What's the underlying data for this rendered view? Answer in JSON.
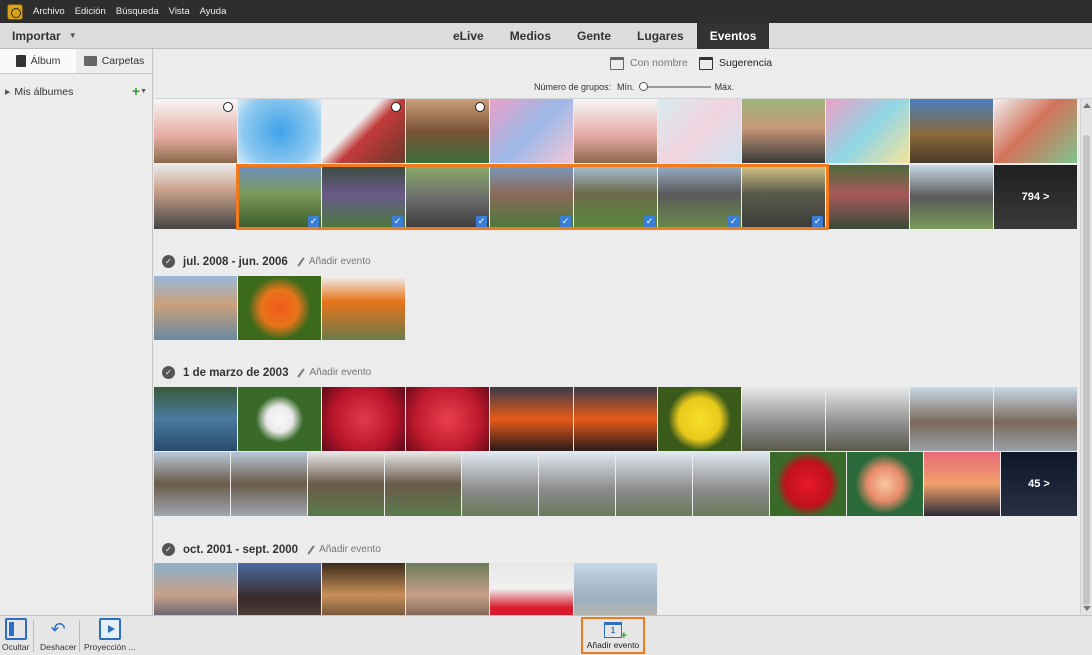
{
  "menu": [
    "Archivo",
    "Edición",
    "Búsqueda",
    "Vista",
    "Ayuda"
  ],
  "import_label": "Importar",
  "tabs": [
    "eLive",
    "Medios",
    "Gente",
    "Lugares",
    "Eventos"
  ],
  "active_tab": "Eventos",
  "left_panel": {
    "tab_album": "Álbum",
    "tab_folders": "Carpetas",
    "my_albums": "Mis álbumes"
  },
  "view_modes": {
    "named": "Con nombre",
    "suggestion": "Sugerencia"
  },
  "groups": {
    "label": "Número de grupos:",
    "min": "Mín.",
    "max": "Máx."
  },
  "top_group": {
    "more_label": "794 >",
    "row1": [
      {
        "name": "flowers-pots-photo",
        "color": "linear-gradient(#f7f7f7,#e5a9a0 60%,#8a6a4a)",
        "play": true
      },
      {
        "name": "blue-watercolor-photo",
        "color": "radial-gradient(circle,#3fa2e8,#8fcaf0 70%,#d8ecf7)",
        "play": false
      },
      {
        "name": "girl-painting-wall-photo",
        "color": "linear-gradient(135deg,#eee 40%,#c23a3a 55%,#6a3a2a)",
        "play": true
      },
      {
        "name": "smiling-girl-photo",
        "color": "linear-gradient(#c9a07a,#7a5236 50%,#3a6e3a)",
        "play": true
      },
      {
        "name": "pink-watercolor-photo",
        "color": "linear-gradient(135deg,#e9a0c8,#9bb9e8 50%,#f3c6d8)",
        "play": false
      },
      {
        "name": "flowers-pots-photo-2",
        "color": "linear-gradient(#f7f7f7,#e3a6a0 60%,#8a6a4a)",
        "play": false
      },
      {
        "name": "pastel-watercolor-photo",
        "color": "linear-gradient(135deg,#d9ecef,#f1d3df 50%,#cfe3ef)",
        "play": false
      },
      {
        "name": "smiling-man-photo",
        "color": "linear-gradient(#9bb57a,#c79878 45%,#3a3a3a)",
        "play": false
      },
      {
        "name": "rainbow-watercolor-photo",
        "color": "linear-gradient(135deg,#ee9fc4,#8fd6e6 50%,#f6e39a)",
        "play": false
      },
      {
        "name": "mountain-biker-photo",
        "color": "linear-gradient(#4a7fc0,#8a6a3a 55%,#4a3a2a)",
        "play": false
      },
      {
        "name": "green-watercolor-photo",
        "color": "linear-gradient(135deg,#f1f1f1,#d2735a 45%,#7fc48f)",
        "play": false
      }
    ],
    "row2": [
      {
        "name": "man-suit-photo",
        "color": "linear-gradient(#e9e9e9,#c9a08a 40%,#444)",
        "checked": false
      },
      {
        "name": "family-lawn-photo-1",
        "color": "linear-gradient(#6a8fc0,#7a9a5a 45%,#3a5a2a)",
        "checked": true
      },
      {
        "name": "family-lawn-photo-2",
        "color": "linear-gradient(#3a4a3a,#6a5a8a 45%,#4a7a3a)",
        "checked": true
      },
      {
        "name": "family-road-photo-1",
        "color": "linear-gradient(#8aaa6a,#6a6a6a 55%,#3a3a3a)",
        "checked": true
      },
      {
        "name": "family-lawn-photo-3",
        "color": "linear-gradient(#7a9ac0,#8a6a5a 45%,#4a7a3a)",
        "checked": true
      },
      {
        "name": "family-lawn-photo-4",
        "color": "linear-gradient(#aac0d8,#6a6a4a 45%,#5a8a3a)",
        "checked": true
      },
      {
        "name": "family-road-photo-2",
        "color": "linear-gradient(#9ab0c8,#5a5a5a 45%,#6a8a4a)",
        "checked": true
      },
      {
        "name": "family-road-photo-3",
        "color": "linear-gradient(#d8c88a,#5a5a4a 45%,#3a3a3a)",
        "checked": true
      },
      {
        "name": "family-bench-photo",
        "color": "linear-gradient(#4a6a3a,#a85a5a 45%,#3a4a3a)",
        "checked": false
      },
      {
        "name": "family-road-photo-4",
        "color": "linear-gradient(#c8d8e8,#5a5a5a 50%,#7a9a5a)",
        "checked": false
      },
      {
        "name": "more-photos-tile",
        "color": "linear-gradient(#3a3a3a,#6a6a6a)",
        "checked": false,
        "more": true
      }
    ]
  },
  "events": [
    {
      "title": "jul. 2008 - jun. 2006",
      "add_label": "Añadir evento",
      "photos": [
        {
          "name": "girl-lake-photo",
          "color": "linear-gradient(#9ab8d8,#c9a07a 45%,#6a8aa0)"
        },
        {
          "name": "orange-poppy-photo",
          "color": "radial-gradient(circle,#f05a1a,#e8741a 35%,#3a6a1a 60%)"
        },
        {
          "name": "poppy-field-photo",
          "color": "linear-gradient(#f1f1f1,#e8741a 40%,#6a7a4a)"
        }
      ]
    },
    {
      "title": "1 de marzo de 2003",
      "add_label": "Añadir evento",
      "more_label": "45 >",
      "row1": [
        {
          "name": "wakeboard-photo",
          "color": "linear-gradient(#3a5a3a,#4a7aa0 50%,#2a4a6a)"
        },
        {
          "name": "white-flower-photo",
          "color": "radial-gradient(circle,#fafafa,#eaeaea 25%,#3a6a2a 45%)"
        },
        {
          "name": "red-dahlia-photo-1",
          "color": "radial-gradient(circle,#e23a4a,#b8142a 60%,#5a0a1a)"
        },
        {
          "name": "red-dahlia-photo-2",
          "color": "radial-gradient(circle,#e8404e,#c01a2e 60%,#6a0a1a)"
        },
        {
          "name": "sunset-photo-1",
          "color": "linear-gradient(#3a3a4a,#e85a1a 50%,#2a1a1a)"
        },
        {
          "name": "sunset-photo-2",
          "color": "linear-gradient(#3a3a4a,#e85a1a 50%,#2a1a1a)"
        },
        {
          "name": "yellow-daisy-photo",
          "color": "radial-gradient(circle,#f8e02a,#e8c81a 40%,#3a5a1a 60%)"
        },
        {
          "name": "eiffel-base-photo-1",
          "color": "linear-gradient(#e8e8e8,#8a8a8a 60%,#5a5a4a)"
        },
        {
          "name": "eiffel-base-photo-2",
          "color": "linear-gradient(#e8e8e8,#8a8a8a 60%,#5a5a4a)"
        },
        {
          "name": "eiffel-tower-photo-1",
          "color": "linear-gradient(#c8d8e8,#7a6a5a 55%,#9aa0a8)"
        },
        {
          "name": "eiffel-tower-photo-2",
          "color": "linear-gradient(#c8d8e8,#7a6a5a 55%,#9aa0a8)"
        }
      ],
      "row2": [
        {
          "name": "eiffel-tower-photo-3",
          "color": "linear-gradient(#b8c8d8,#6a5a4a 50%,#a0a8b0)"
        },
        {
          "name": "eiffel-tower-photo-4",
          "color": "linear-gradient(#b8c8d8,#6a5a4a 50%,#a0a8b0)"
        },
        {
          "name": "eiffel-arch-photo-1",
          "color": "linear-gradient(#e8e8e8,#6a5a4a 50%,#5a7a4a)"
        },
        {
          "name": "eiffel-arch-photo-2",
          "color": "linear-gradient(#e8e8e8,#6a5a4a 50%,#5a7a4a)"
        },
        {
          "name": "eiffel-far-photo-1",
          "color": "linear-gradient(#e0e8f0,#8a8a8a 60%,#6a7a5a)"
        },
        {
          "name": "eiffel-far-photo-2",
          "color": "linear-gradient(#e0e8f0,#8a8a8a 60%,#6a7a5a)"
        },
        {
          "name": "eiffel-far-photo-3",
          "color": "linear-gradient(#e0e8f0,#8a8a8a 60%,#6a7a5a)"
        },
        {
          "name": "eiffel-far-photo-4",
          "color": "linear-gradient(#e0e8f0,#8a8a8a 60%,#6a7a5a)"
        },
        {
          "name": "red-rose-photo",
          "color": "radial-gradient(circle,#e81a2a,#c0101e 45%,#3a6a2a 65%)"
        },
        {
          "name": "lily-photo",
          "color": "radial-gradient(circle,#f8c8a0,#e88a6a 35%,#2a6a3a 60%)"
        },
        {
          "name": "sunset-sea-photo",
          "color": "linear-gradient(#e86a7a,#f0a06a 50%,#2a2a3a)"
        },
        {
          "name": "more-photos-tile-2",
          "color": "linear-gradient(#1a2a4a,#4a5a7a)",
          "more": true
        }
      ]
    },
    {
      "title": "oct. 2001 - sept. 2000",
      "add_label": "Añadir evento",
      "photos": [
        {
          "name": "boy-helmet-photo",
          "color": "linear-gradient(#8ab0c8,#c8a08a 50%,#3a4a6a)"
        },
        {
          "name": "horse-rider-photo",
          "color": "linear-gradient(#4a6aa0,#3a2a2a 55%,#5a4a3a)"
        },
        {
          "name": "kids-indoor-photo",
          "color": "linear-gradient(#3a2a1a,#c8905a 50%,#4a3a2a)"
        },
        {
          "name": "family-portrait-photo",
          "color": "linear-gradient(#6a7a5a,#c8a08a 50%,#5a4a3a)"
        },
        {
          "name": "tulip-photo",
          "color": "linear-gradient(#e8e8e8,#f0f0f0 40%,#d81a2a 70%)"
        },
        {
          "name": "beach-person-photo",
          "color": "linear-gradient(#c8d8e8,#9ab0c0 55%,#c8b8a0)"
        }
      ]
    }
  ],
  "bottom": {
    "hide": "Ocultar",
    "undo": "Deshacer",
    "slideshow": "Proyección ...",
    "add_event": "Añadir evento",
    "add_event_icon_digit": "1"
  }
}
